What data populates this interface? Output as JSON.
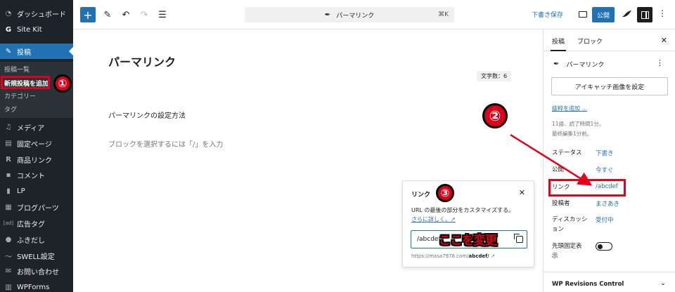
{
  "admin_menu": {
    "items": [
      {
        "label": "ダッシュボード",
        "icon": "dashboard-icon"
      },
      {
        "label": "Site Kit",
        "icon": "google-g-icon"
      },
      {
        "label": "投稿",
        "icon": "pin-icon"
      },
      {
        "label": "メディア",
        "icon": "media-icon"
      },
      {
        "label": "固定ページ",
        "icon": "pages-icon"
      },
      {
        "label": "商品リンク",
        "icon": "r-icon"
      },
      {
        "label": "コメント",
        "icon": "comment-icon"
      },
      {
        "label": "LP",
        "icon": "lp-icon"
      },
      {
        "label": "ブログパーツ",
        "icon": "parts-icon"
      },
      {
        "label": "広告タグ",
        "icon": "ad-icon"
      },
      {
        "label": "ふきだし",
        "icon": "bubble-icon"
      },
      {
        "label": "SWELL設定",
        "icon": "swell-icon"
      },
      {
        "label": "お問い合わせ",
        "icon": "mail-icon"
      },
      {
        "label": "WPForms",
        "icon": "wpforms-icon"
      }
    ],
    "subitems": [
      {
        "label": "投稿一覧"
      },
      {
        "label": "新規投稿を追加"
      },
      {
        "label": "カテゴリー"
      },
      {
        "label": "タグ"
      }
    ]
  },
  "toolbar": {
    "add_icon": "plus-icon",
    "command_title": "パーマリンク",
    "command_shortcut": "⌘K",
    "save_draft": "下書き保存",
    "publish": "公開"
  },
  "editor": {
    "post_title": "パーマリンク",
    "word_count": "文字数：6",
    "heading": "パーマリンクの設定方法",
    "block_placeholder": "ブロックを選択するには「/」を入力"
  },
  "link_popover": {
    "title": "リンク",
    "description": "URL の最後の部分をカスタマイズする。",
    "learn_more": "さらに詳しく。↗",
    "slug_value": "/abcdef",
    "url_prefix": "https://masa7978.com/",
    "url_slug": "abcdef/",
    "url_suffix": " ↗"
  },
  "settings_panel": {
    "tabs": [
      "投稿",
      "ブロック"
    ],
    "post_type": "パーマリンク",
    "featured_image": "アイキャッチ画像を設定",
    "add_excerpt": "抜粋を追加 ...",
    "stats_line1": "11語、読了時間1分。",
    "stats_line2": "最終編集1分前。",
    "rows": [
      {
        "label": "ステータス",
        "value": "下書き"
      },
      {
        "label": "公開",
        "value": "今すぐ"
      },
      {
        "label": "リンク",
        "value": "/abcdef"
      },
      {
        "label": "投稿者",
        "value": "まさあき"
      },
      {
        "label": "ディスカッション",
        "value": "受付中"
      },
      {
        "label": "先頭固定表示",
        "value": ""
      }
    ],
    "sticky_enabled": false,
    "revisions_title": "WP Revisions Control"
  },
  "annotations": {
    "badge1": "①",
    "badge2": "②",
    "badge3": "③",
    "note": "ここを変更",
    "highlight_color": "#e4001a"
  },
  "colors": {
    "admin_bg": "#1d2327",
    "accent": "#2271b1"
  }
}
